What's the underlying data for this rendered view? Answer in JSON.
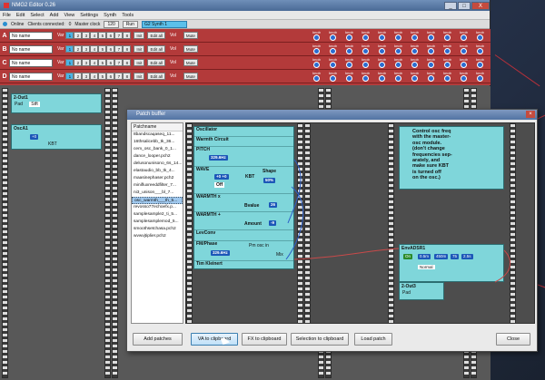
{
  "window": {
    "title": "NMG2 Editor 0.26",
    "controls": [
      "_",
      "□",
      "X"
    ]
  },
  "menu": [
    "File",
    "Edit",
    "Select",
    "Add",
    "View",
    "Settings",
    "Synth",
    "Tools"
  ],
  "toolbar": {
    "online_label": "Online",
    "clients_label": "Clients connected:",
    "clients_value": "0",
    "master_clock_label": "Master clock",
    "bpm_value": "120",
    "run_label": "Run",
    "synth_field": "G2 Synth 1"
  },
  "slots": [
    {
      "letter": "A",
      "name": "No name",
      "var_label": "Var",
      "vars": [
        "1",
        "2",
        "3",
        "4",
        "5",
        "6",
        "7",
        "8"
      ],
      "init": "Init",
      "edit_all": "Edit all",
      "vol": "Vol",
      "mute": "Mute"
    },
    {
      "letter": "B",
      "name": "No name",
      "var_label": "Var",
      "vars": [
        "1",
        "2",
        "3",
        "4",
        "5",
        "6",
        "7",
        "8"
      ],
      "init": "Init",
      "edit_all": "Edit all",
      "vol": "Vol",
      "mute": "Mute"
    },
    {
      "letter": "C",
      "name": "No name",
      "var_label": "Var",
      "vars": [
        "1",
        "2",
        "3",
        "4",
        "5",
        "6",
        "7",
        "8"
      ],
      "init": "Init",
      "edit_all": "Edit all",
      "vol": "Vol",
      "mute": "Mute"
    },
    {
      "letter": "D",
      "name": "No name",
      "var_label": "Var",
      "vars": [
        "1",
        "2",
        "3",
        "4",
        "5",
        "6",
        "7",
        "8"
      ],
      "init": "Init",
      "edit_all": "Edit all",
      "vol": "Vol",
      "mute": "Mute"
    }
  ],
  "knob_label": "knob",
  "main_modules": {
    "out": {
      "title": "2-Out1",
      "sub": "Pad",
      "tag": "Stft"
    },
    "osc": {
      "title": "OscA1",
      "freq": "+0",
      "sub": "KBT"
    }
  },
  "dialog": {
    "title": "Patch buffer",
    "list_header": "Patchname",
    "patches": [
      "8bandscaqaseq_11...",
      "16thsalicebb_tk_36...",
      "cem_osc_bank_0_1...",
      "dance_looper.pch2",
      "delusonunisono_6s_14...",
      "elastaudio_bb_tk_4...",
      "maasinephaser.pch2",
      "minifluxreeddfilter_7...",
      "ni3_unison___bl_7...",
      "osc_warmth___th_5...",
      "revosso77echoefx.p...",
      "samplesample2_ti_5...",
      "samplesamplemod_5...",
      "smoothsetchasa.pch2",
      "wvwvjtiplier.pch2"
    ],
    "selected_index": 9,
    "modules": {
      "osc_title": "Oscillator",
      "osc_sub": "Warmth Circuit",
      "pitch": "PITCH",
      "pitch_val": "329.6Hz",
      "wave": "WAVE",
      "wave_val": "+0 +0",
      "kbt": "KBT",
      "off": "Off",
      "shape": "Shape",
      "shape_val": "50%",
      "warmth_x": "WARMTH x",
      "warmth_plus": "WARMTH +",
      "bvalue": "Bvalue",
      "bvalue_num": "26",
      "amount": "Amount",
      "amount_num": "-9",
      "lev_conv": "LevConv",
      "fm_phase": "FM/Phase",
      "fm_val": "329.6Hz",
      "author": "Tim Kleinert",
      "pm_osc_in": "Pm osc in",
      "mix": "Mix",
      "note_text": [
        "Control osc freq",
        "with the master-",
        "osc module.",
        "(don't change",
        "frequencies sep-",
        "arately, and",
        "make sure KBT",
        "is turned off",
        "on the osc.)"
      ],
      "env_title": "EnvADSR1",
      "env_on": "On",
      "env_vals": [
        "0.5m",
        "450m",
        "75",
        "2.5s"
      ],
      "env_mode": "Normal",
      "xout_title": "2-Out3",
      "xout_sub": "Pad"
    },
    "buttons": [
      "Add patches",
      "VA to clipboard",
      "FX to clipboard",
      "Selection to clipboard",
      "Load patch",
      "Close"
    ]
  }
}
